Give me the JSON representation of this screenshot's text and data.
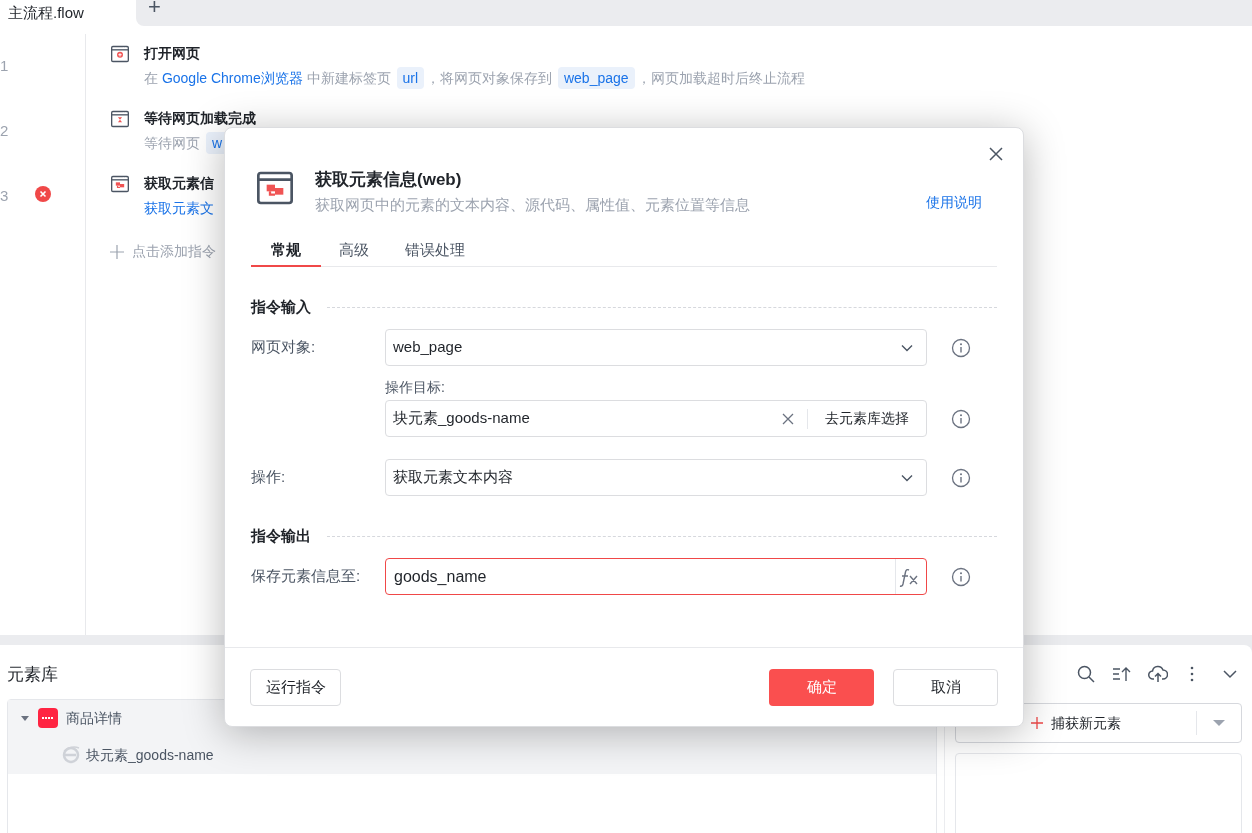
{
  "tabs": [
    {
      "label": "主流程.flow",
      "selected": true
    }
  ],
  "add_tab": "+",
  "steps": [
    {
      "number": "1",
      "kind": "open",
      "title": "打开网页",
      "error": false,
      "description": [
        {
          "kind": "text",
          "text": "在 "
        },
        {
          "kind": "link",
          "text": "Google Chrome浏览器"
        },
        {
          "kind": "text",
          "text": " 中新建标签页 "
        },
        {
          "kind": "var",
          "text": "url"
        },
        {
          "kind": "text",
          "text": "，将网页对象保存到 "
        },
        {
          "kind": "var",
          "text": "web_page"
        },
        {
          "kind": "text",
          "text": "，网页加载超时后终止流程"
        }
      ]
    },
    {
      "number": "2",
      "kind": "wait",
      "title": "等待网页加载完成",
      "error": false,
      "description": [
        {
          "kind": "text",
          "text": "等待网页 "
        },
        {
          "kind": "var",
          "text": "w"
        }
      ]
    },
    {
      "number": "3",
      "kind": "element",
      "title": "获取元素信",
      "error": true,
      "description": [
        {
          "kind": "link",
          "text": "获取元素文"
        }
      ]
    }
  ],
  "add_step": "点击添加指令",
  "element_library": {
    "title": "元素库",
    "tree": [
      {
        "label": "商品详情",
        "expanded": true,
        "selected": false,
        "children": [
          {
            "label": "块元素_goods-name",
            "selected": true
          }
        ]
      }
    ],
    "capture_button": "捕获新元素"
  },
  "dialog": {
    "title": "获取元素信息(web)",
    "subtitle": "获取网页中的元素的文本内容、源代码、属性值、元素位置等信息",
    "help_link": "使用说明",
    "tabs": [
      {
        "label": "常规",
        "selected": true
      },
      {
        "label": "高级",
        "selected": false
      },
      {
        "label": "错误处理",
        "selected": false
      }
    ],
    "sections": [
      {
        "title": "指令输入",
        "fields": [
          {
            "kind": "select",
            "label": "网页对象:",
            "value": "web_page"
          },
          {
            "kind": "target",
            "label": "操作目标:",
            "value": "块元素_goods-name",
            "action": "去元素库选择"
          },
          {
            "kind": "select",
            "label": "操作:",
            "value": "获取元素文本内容"
          }
        ]
      },
      {
        "title": "指令输出",
        "fields": [
          {
            "kind": "expression",
            "label": "保存元素信息至:",
            "value": "goods_name",
            "focused": true
          }
        ]
      }
    ],
    "buttons": [
      {
        "label": "运行指令",
        "kind": "default"
      },
      {
        "label": "确定",
        "kind": "primary"
      },
      {
        "label": "取消",
        "kind": "default"
      }
    ]
  }
}
